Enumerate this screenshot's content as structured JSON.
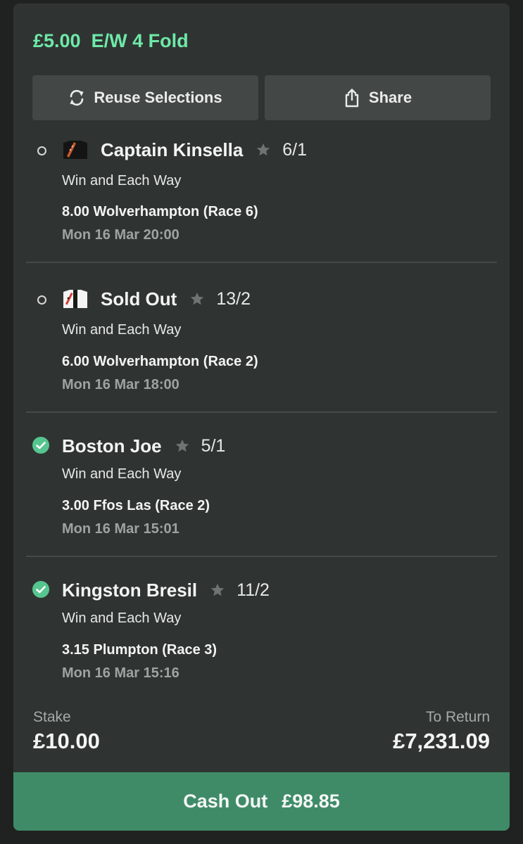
{
  "bet": {
    "stake_label": "£5.00",
    "type_label": "E/W 4 Fold"
  },
  "actions": {
    "reuse_label": "Reuse Selections",
    "share_label": "Share"
  },
  "selections": [
    {
      "name": "Captain Kinsella",
      "odds": "6/1",
      "market": "Win and Each Way",
      "event": "8.00 Wolverhampton (Race 6)",
      "time": "Mon 16 Mar 20:00",
      "status": "open",
      "silks": "silks-icon"
    },
    {
      "name": "Sold Out",
      "odds": "13/2",
      "market": "Win and Each Way",
      "event": "6.00 Wolverhampton (Race 2)",
      "time": "Mon 16 Mar 18:00",
      "status": "open",
      "silks": "silks-icon"
    },
    {
      "name": "Boston Joe",
      "odds": "5/1",
      "market": "Win and Each Way",
      "event": "3.00 Ffos Las (Race 2)",
      "time": "Mon 16 Mar 15:01",
      "status": "won"
    },
    {
      "name": "Kingston Bresil",
      "odds": "11/2",
      "market": "Win and Each Way",
      "event": "3.15 Plumpton (Race 3)",
      "time": "Mon 16 Mar 15:16",
      "status": "won"
    }
  ],
  "summary": {
    "stake_label": "Stake",
    "stake_value": "£10.00",
    "return_label": "To Return",
    "return_value": "£7,231.09"
  },
  "cashout": {
    "label": "Cash Out",
    "amount": "£98.85"
  },
  "colors": {
    "accent_green": "#6ee9a8",
    "cashout_green": "#3f8b68",
    "card_bg": "#2f3432"
  }
}
